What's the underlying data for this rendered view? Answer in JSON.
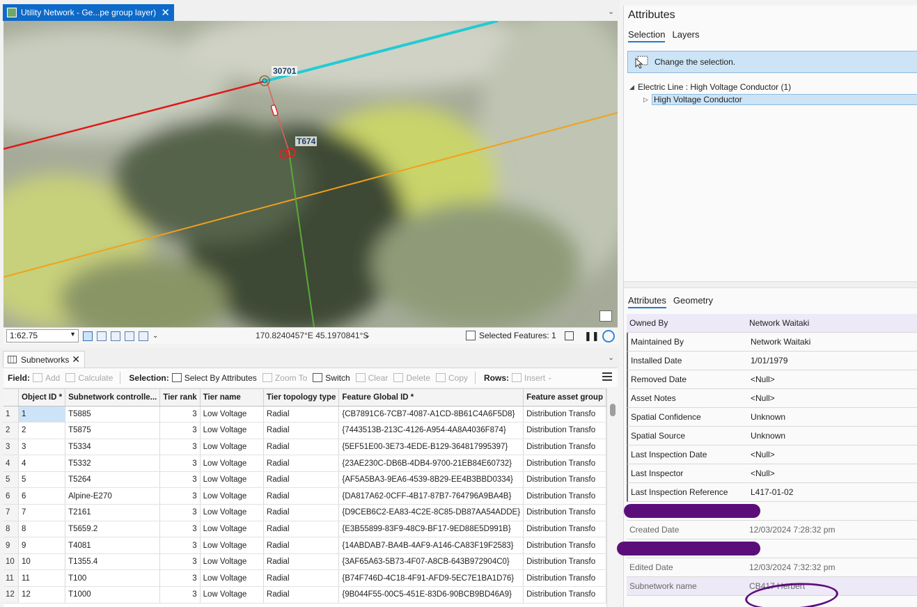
{
  "map_tab": {
    "title": "Utility Network - Ge...pe group layer)",
    "close": "✕"
  },
  "map": {
    "label_a": "30701",
    "label_b": "T674",
    "colors": {
      "red_line": "#e01818",
      "cyan_line": "#21cbd4",
      "orange_line": "#f2a11a",
      "green_line": "#5aaa3a",
      "marker": "#d22"
    }
  },
  "statusbar": {
    "scale": "1:62.75",
    "coordinates": "170.8240457°E 45.1970841°S",
    "selected_features": "Selected Features: 1"
  },
  "table_tab": {
    "title": "Subnetworks",
    "close": "✕"
  },
  "toolbar": {
    "field_label": "Field:",
    "add": "Add",
    "calculate": "Calculate",
    "selection_label": "Selection:",
    "select_by_attributes": "Select By Attributes",
    "zoom_to": "Zoom To",
    "switch": "Switch",
    "clear": "Clear",
    "delete": "Delete",
    "copy": "Copy",
    "rows_label": "Rows:",
    "insert": "Insert"
  },
  "grid": {
    "columns": [
      "Object ID *",
      "Subnetwork controlle...",
      "Tier rank",
      "Tier name",
      "Tier topology type",
      "Feature Global ID *",
      "Feature asset group"
    ],
    "rows": [
      [
        "1",
        "1",
        "T5885",
        "3",
        "Low Voltage",
        "Radial",
        "{CB7891C6-7CB7-4087-A1CD-8B61C4A6F5D8}",
        "Distribution Transfo"
      ],
      [
        "2",
        "2",
        "T5875",
        "3",
        "Low Voltage",
        "Radial",
        "{7443513B-213C-4126-A954-4A8A4036F874}",
        "Distribution Transfo"
      ],
      [
        "3",
        "3",
        "T5334",
        "3",
        "Low Voltage",
        "Radial",
        "{5EF51E00-3E73-4EDE-B129-364817995397}",
        "Distribution Transfo"
      ],
      [
        "4",
        "4",
        "T5332",
        "3",
        "Low Voltage",
        "Radial",
        "{23AE230C-DB6B-4DB4-9700-21EB84E60732}",
        "Distribution Transfo"
      ],
      [
        "5",
        "5",
        "T5264",
        "3",
        "Low Voltage",
        "Radial",
        "{AF5A5BA3-9EA6-4539-8B29-EE4B3BBD0334}",
        "Distribution Transfo"
      ],
      [
        "6",
        "6",
        "Alpine-E270",
        "3",
        "Low Voltage",
        "Radial",
        "{DA817A62-0CFF-4B17-87B7-764796A9BA4B}",
        "Distribution Transfo"
      ],
      [
        "7",
        "7",
        "T2161",
        "3",
        "Low Voltage",
        "Radial",
        "{D9CEB6C2-EA83-4C2E-8C85-DB87AA54ADDE}",
        "Distribution Transfo"
      ],
      [
        "8",
        "8",
        "T5659.2",
        "3",
        "Low Voltage",
        "Radial",
        "{E3B55899-83F9-48C9-BF17-9ED88E5D991B}",
        "Distribution Transfo"
      ],
      [
        "9",
        "9",
        "T4081",
        "3",
        "Low Voltage",
        "Radial",
        "{14ABDAB7-BA4B-4AF9-A146-CA83F19F2583}",
        "Distribution Transfo"
      ],
      [
        "10",
        "10",
        "T1355.4",
        "3",
        "Low Voltage",
        "Radial",
        "{3AF65A63-5B73-4F07-A8CB-643B972904C0}",
        "Distribution Transfo"
      ],
      [
        "11",
        "11",
        "T100",
        "3",
        "Low Voltage",
        "Radial",
        "{B74F746D-4C18-4F91-AFD9-5EC7E1BA1D76}",
        "Distribution Transfo"
      ],
      [
        "12",
        "12",
        "T1000",
        "3",
        "Low Voltage",
        "Radial",
        "{9B044F55-00C5-451E-83D6-90BCB9BD46A9}",
        "Distribution Transfo"
      ]
    ]
  },
  "attributes": {
    "title": "Attributes",
    "tabs": [
      "Selection",
      "Layers"
    ],
    "banner": "Change the selection.",
    "tree_parent": "Electric Line : High Voltage Conductor (1)",
    "tree_child": "High Voltage Conductor",
    "subtabs": [
      "Attributes",
      "Geometry"
    ],
    "fields": [
      {
        "k": "Owned By",
        "v": "Network Waitaki"
      },
      {
        "k": "Maintained By",
        "v": "Network Waitaki"
      },
      {
        "k": "Installed Date",
        "v": "1/01/1979"
      },
      {
        "k": "Removed Date",
        "v": "<Null>"
      },
      {
        "k": "Asset Notes",
        "v": "<Null>"
      },
      {
        "k": "Spatial Confidence",
        "v": "Unknown"
      },
      {
        "k": "Spatial Source",
        "v": "Unknown"
      },
      {
        "k": "Last Inspection Date",
        "v": "<Null>"
      },
      {
        "k": "Last Inspector",
        "v": "<Null>"
      },
      {
        "k": "Last Inspection Reference",
        "v": "L417-01-02"
      },
      {
        "k": "Created By",
        "v": ""
      },
      {
        "k": "Created Date",
        "v": "12/03/2024 7:28:32 pm"
      },
      {
        "k": "Edited By",
        "v": ""
      },
      {
        "k": "Edited Date",
        "v": "12/03/2024 7:32:32 pm"
      },
      {
        "k": "Subnetwork name",
        "v": "CB417 Herbert"
      }
    ],
    "redaction_color": "#5b0e7a"
  }
}
